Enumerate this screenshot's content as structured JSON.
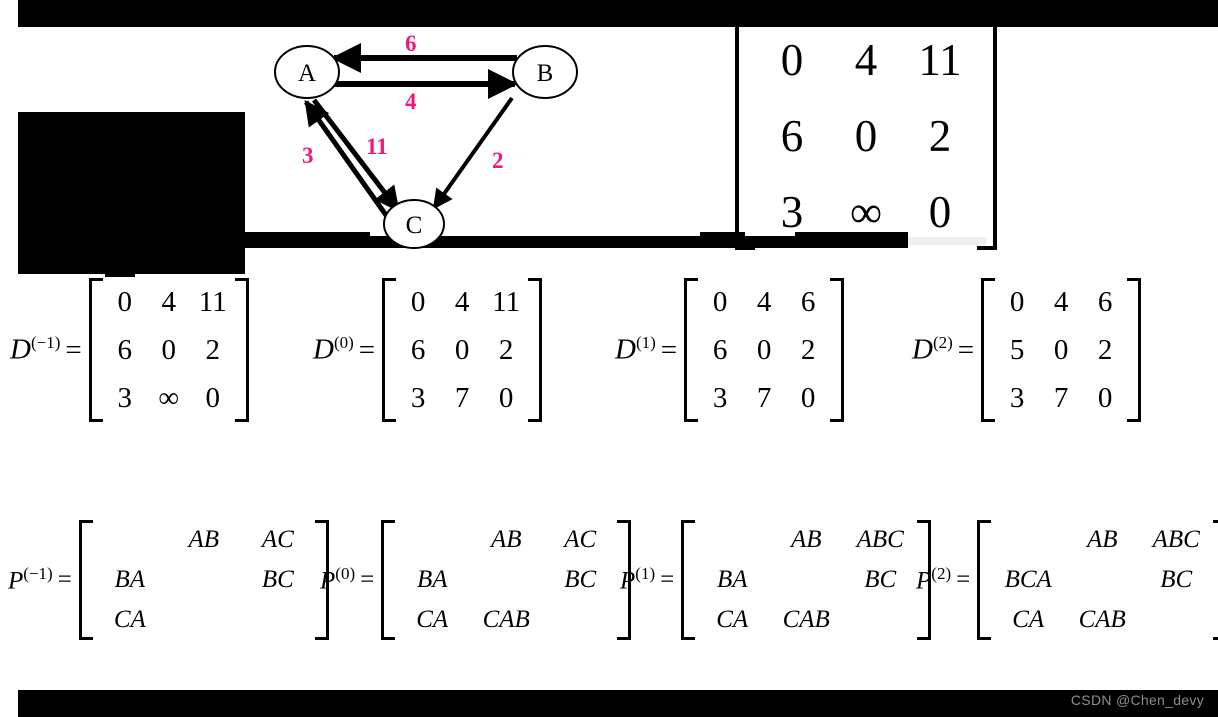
{
  "colors": {
    "edge_weight": "#f0197a",
    "redaction": "#000000",
    "background": "#ffffff",
    "watermark": "#8e8e8e"
  },
  "graph": {
    "nodes": [
      {
        "id": "A",
        "label": "A"
      },
      {
        "id": "B",
        "label": "B"
      },
      {
        "id": "C",
        "label": "C"
      }
    ],
    "edges": [
      {
        "from": "B",
        "to": "A",
        "weight": "6"
      },
      {
        "from": "A",
        "to": "B",
        "weight": "4"
      },
      {
        "from": "C",
        "to": "A",
        "weight": "3"
      },
      {
        "from": "A",
        "to": "C",
        "weight": "11"
      },
      {
        "from": "B",
        "to": "C",
        "weight": "2"
      }
    ]
  },
  "matrix_top_right": {
    "rows": [
      [
        "0",
        "4",
        "11"
      ],
      [
        "6",
        "0",
        "2"
      ],
      [
        "3",
        "∞",
        "0"
      ]
    ]
  },
  "d_matrices": [
    {
      "name": "D",
      "superscript": "(−1)",
      "equals": "=",
      "rows": [
        [
          "0",
          "4",
          "11"
        ],
        [
          "6",
          "0",
          "2"
        ],
        [
          "3",
          "∞",
          "0"
        ]
      ]
    },
    {
      "name": "D",
      "superscript": "(0)",
      "equals": "=",
      "rows": [
        [
          "0",
          "4",
          "11"
        ],
        [
          "6",
          "0",
          "2"
        ],
        [
          "3",
          "7",
          "0"
        ]
      ]
    },
    {
      "name": "D",
      "superscript": "(1)",
      "equals": "=",
      "rows": [
        [
          "0",
          "4",
          "6"
        ],
        [
          "6",
          "0",
          "2"
        ],
        [
          "3",
          "7",
          "0"
        ]
      ]
    },
    {
      "name": "D",
      "superscript": "(2)",
      "equals": "=",
      "rows": [
        [
          "0",
          "4",
          "6"
        ],
        [
          "5",
          "0",
          "2"
        ],
        [
          "3",
          "7",
          "0"
        ]
      ]
    }
  ],
  "p_matrices": [
    {
      "name": "P",
      "superscript": "(−1)",
      "equals": "=",
      "rows": [
        [
          "",
          "AB",
          "AC"
        ],
        [
          "BA",
          "",
          "BC"
        ],
        [
          "CA",
          "",
          ""
        ]
      ]
    },
    {
      "name": "P",
      "superscript": "(0)",
      "equals": "=",
      "rows": [
        [
          "",
          "AB",
          "AC"
        ],
        [
          "BA",
          "",
          "BC"
        ],
        [
          "CA",
          "CAB",
          ""
        ]
      ]
    },
    {
      "name": "P",
      "superscript": "(1)",
      "equals": "=",
      "rows": [
        [
          "",
          "AB",
          "ABC"
        ],
        [
          "BA",
          "",
          "BC"
        ],
        [
          "CA",
          "CAB",
          ""
        ]
      ]
    },
    {
      "name": "P",
      "superscript": "(2)",
      "equals": "=",
      "rows": [
        [
          "",
          "AB",
          "ABC"
        ],
        [
          "BCA",
          "",
          "BC"
        ],
        [
          "CA",
          "CAB",
          ""
        ]
      ]
    }
  ],
  "watermark": {
    "text": "CSDN @Chen_devy"
  }
}
